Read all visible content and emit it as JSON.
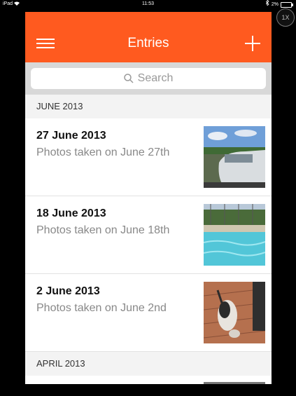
{
  "status_bar": {
    "device": "iPad",
    "wifi_icon": "wifi-icon",
    "time": "11:53",
    "bluetooth_icon": "bluetooth-icon",
    "battery_percent": "2%",
    "battery_level": 0.02
  },
  "zoom_button": {
    "label": "1X"
  },
  "navbar": {
    "title": "Entries",
    "menu_icon": "hamburger-menu-icon",
    "add_icon": "plus-icon",
    "color": "#ff5a1f"
  },
  "search": {
    "placeholder": "Search",
    "icon": "search-icon"
  },
  "sections": [
    {
      "header": "JUNE 2013",
      "entries": [
        {
          "title": "27 June 2013",
          "subtitle": "Photos taken on June 27th",
          "thumbnail": "car-photo"
        },
        {
          "title": "18 June 2013",
          "subtitle": "Photos taken on June 18th",
          "thumbnail": "pool-photo"
        },
        {
          "title": "2 June 2013",
          "subtitle": "Photos taken on June 2nd",
          "thumbnail": "dog-photo"
        }
      ]
    },
    {
      "header": "APRIL 2013"
    }
  ]
}
